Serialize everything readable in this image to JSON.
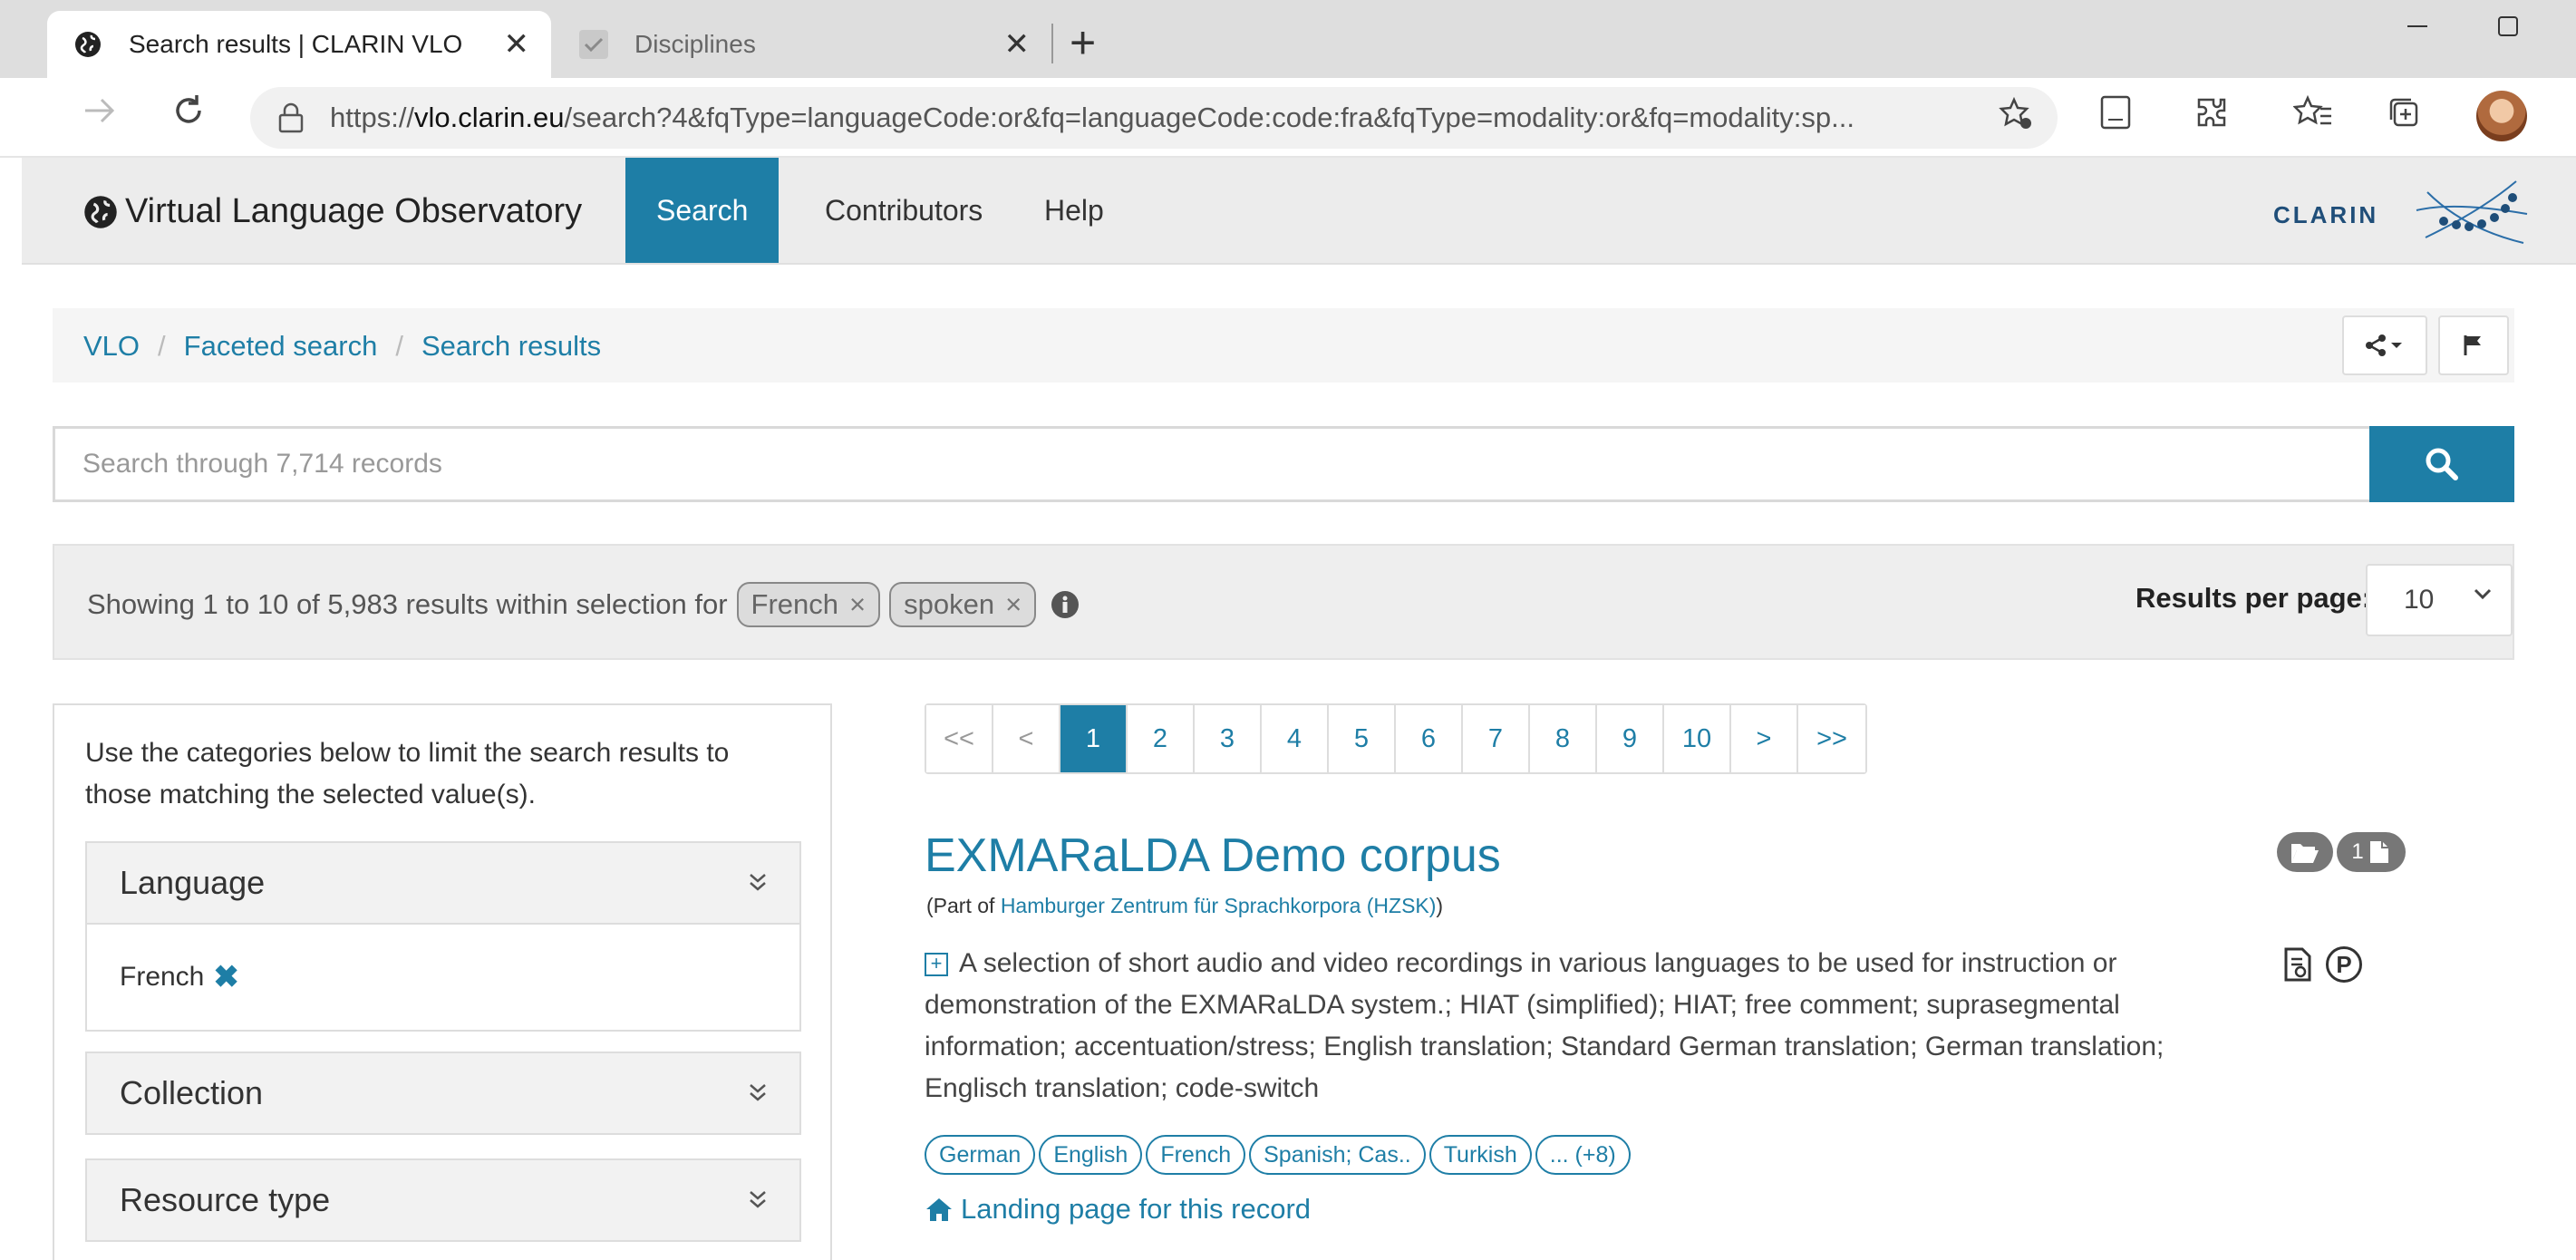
{
  "browser": {
    "tabs": [
      {
        "title": "Search results | CLARIN VLO",
        "active": true,
        "icon": "globe-icon"
      },
      {
        "title": "Disciplines",
        "active": false,
        "icon": "check-icon"
      }
    ],
    "close_glyph": "✕",
    "new_tab_glyph": "+",
    "url_prefix": "https://",
    "url_host": "vlo.clarin.eu",
    "url_rest": "/search?4&fqType=languageCode:or&fq=languageCode:code:fra&fqType=modality:or&fq=modality:sp..."
  },
  "site": {
    "brand": "Virtual Language Observatory",
    "nav": [
      {
        "label": "Search",
        "active": true
      },
      {
        "label": "Contributors",
        "active": false
      },
      {
        "label": "Help",
        "active": false
      }
    ],
    "logo_text": "CLARIN",
    "accent": "#1e7ea6"
  },
  "breadcrumb": {
    "items": [
      "VLO",
      "Faceted search",
      "Search results"
    ],
    "separator": "/"
  },
  "search": {
    "placeholder": "Search through 7,714 records"
  },
  "selection": {
    "text": "Showing 1 to 10 of 5,983 results within selection for",
    "chips": [
      "French",
      "spoken"
    ],
    "chip_remove": "×",
    "results_per_page_label": "Results per page:",
    "results_per_page_value": "10"
  },
  "facets": {
    "intro": "Use the categories below to limit the search results to those matching the selected value(s).",
    "items": [
      {
        "label": "Language",
        "selected": "French",
        "remove_glyph": "✖"
      },
      {
        "label": "Collection"
      },
      {
        "label": "Resource type"
      }
    ]
  },
  "pagination": [
    "<<",
    "<",
    "1",
    "2",
    "3",
    "4",
    "5",
    "6",
    "7",
    "8",
    "9",
    "10",
    ">",
    ">>"
  ],
  "pagination_current": "1",
  "record": {
    "title": "EXMARaLDA Demo corpus",
    "part_of_prefix": "(Part of",
    "part_of_link": "Hamburger Zentrum für Sprachkorpora (HZSK)",
    "part_of_suffix": ")",
    "expand_glyph": "+",
    "description": "A selection of short audio and video recordings in various languages to be used for instruction or demonstration of the EXMARaLDA system.; HIAT (simplified); HIAT; free comment; suprasegmental information; accentuation/stress; English translation; Standard German translation; German translation; Englisch translation; code-switch",
    "languages": [
      "German",
      "English",
      "French",
      "Spanish; Cas..",
      "Turkish",
      "... (+8)"
    ],
    "landing_label": "Landing page for this record",
    "badge_count": "1",
    "badge_p": "P"
  }
}
